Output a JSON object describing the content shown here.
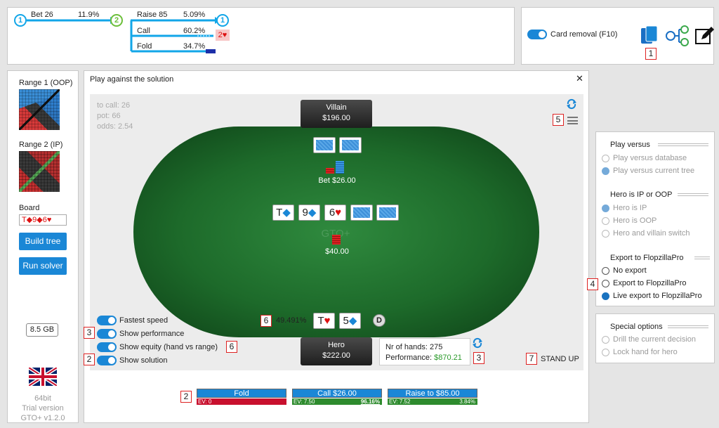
{
  "tree": {
    "node1": "1",
    "bet_label": "Bet 26",
    "bet_pct": "11.9%",
    "node2": "2",
    "raise_label": "Raise 85",
    "raise_pct": "5.09%",
    "node_end": "1",
    "call_label": "Call",
    "call_pct": "60.2%",
    "fold_label": "Fold",
    "fold_pct": "34.7%",
    "call_target": "2♥"
  },
  "top_right": {
    "card_removal_label": "Card removal (F10)",
    "callout_1": "1"
  },
  "left": {
    "range1_label": "Range 1 (OOP)",
    "range2_label": "Range 2 (IP)",
    "board_label": "Board",
    "board_value": "T◆9◆6♥",
    "build_tree": "Build tree",
    "run_solver": "Run solver",
    "memory": "8.5 GB",
    "footer1": "64bit",
    "footer2": "Trial version",
    "footer3": "GTO+ v1.2.0"
  },
  "dialog": {
    "title": "Play against the solution",
    "close": "✕",
    "to_call": "to call: 26",
    "pot": "pot: 66",
    "odds": "odds: 2.54",
    "villain_name": "Villain",
    "villain_stack": "$196.00",
    "bet_amount": "Bet $26.00",
    "pot_amount": "$40.00",
    "watermark": "GTO+",
    "hero_name": "Hero",
    "hero_stack": "$222.00",
    "dealer": "D",
    "equity": "49.491%",
    "nr_hands": "Nr of hands: 275",
    "performance_label": "Performance:",
    "performance_value": "$870.21",
    "stand_up": "STAND UP",
    "toggles": {
      "fastest": "Fastest speed",
      "show_perf": "Show performance",
      "show_equity": "Show equity (hand vs range)",
      "show_solution": "Show solution"
    },
    "board_cards": [
      {
        "rank": "T",
        "suit": "◆",
        "color": "#1a87d6"
      },
      {
        "rank": "9",
        "suit": "◆",
        "color": "#1a87d6"
      },
      {
        "rank": "6",
        "suit": "♥",
        "color": "#d11"
      }
    ],
    "hero_cards": [
      {
        "rank": "T",
        "suit": "♥",
        "color": "#d11"
      },
      {
        "rank": "5",
        "suit": "◆",
        "color": "#1a87d6"
      }
    ]
  },
  "actions": [
    {
      "label": "Fold",
      "ev": "EV: 0",
      "pct": "",
      "color": "#c8102e"
    },
    {
      "label": "Call $26.00",
      "ev": "EV: 7.50",
      "pct": "96.16%",
      "color": "#2e8b2e"
    },
    {
      "label": "Raise to $85.00",
      "ev": "EV: 7.52",
      "pct": "3.84%",
      "color": "#2e8b2e"
    }
  ],
  "options": {
    "play_versus_title": "Play versus",
    "play_db": "Play versus database",
    "play_tree": "Play versus current tree",
    "hero_title": "Hero is IP or OOP",
    "hero_ip": "Hero is IP",
    "hero_oop": "Hero is OOP",
    "hero_switch": "Hero and villain switch",
    "export_title": "Export to FlopzillaPro",
    "no_export": "No export",
    "export": "Export to FlopzillaPro",
    "live_export": "Live export to FlopzillaPro",
    "special_title": "Special options",
    "drill": "Drill the current decision",
    "lock": "Lock hand for hero"
  },
  "callouts": {
    "c1": "1",
    "c2a": "2",
    "c2b": "2",
    "c3a": "3",
    "c3b": "3",
    "c4": "4",
    "c5": "5",
    "c6a": "6",
    "c6b": "6",
    "c7": "7"
  }
}
